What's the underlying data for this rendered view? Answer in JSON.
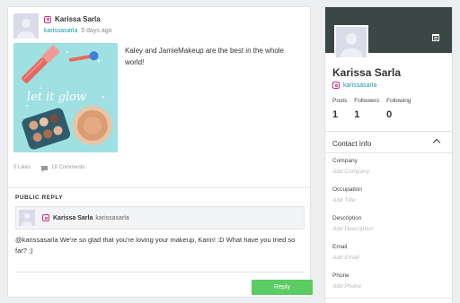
{
  "post": {
    "author_name": "Karissa Sarla",
    "author_handle": "karissasarla",
    "time_ago": "5 days ago",
    "text": "Kaley and JamieMakeup are the best in the whole world!",
    "image_caption": "let it glow",
    "likes": "0 Likes",
    "comments": "18 Comments"
  },
  "reply": {
    "section_title": "PUBLIC REPLY",
    "author_name": "Karissa Sarla",
    "author_handle": "karissasarla",
    "text": "@karissasarla  We're so glad that you're loving your makeup, Karin! :D What have you tried so far? ;)",
    "button_label": "Reply"
  },
  "profile": {
    "name": "Karissa Sarla",
    "handle": "karissasarla",
    "stats": [
      {
        "label": "Posts",
        "value": "1"
      },
      {
        "label": "Followers",
        "value": "1"
      },
      {
        "label": "Following",
        "value": "0"
      }
    ],
    "contact_title": "Contact Info",
    "fields": [
      {
        "label": "Company",
        "placeholder": "Add Company"
      },
      {
        "label": "Occupation",
        "placeholder": "Add Title"
      },
      {
        "label": "Description",
        "placeholder": "Add Description"
      },
      {
        "label": "Email",
        "placeholder": "Add Email"
      },
      {
        "label": "Phone",
        "placeholder": "Add Phone"
      }
    ]
  },
  "colors": {
    "banner": "#3b4744",
    "accent_teal": "#1a9aa5",
    "reply_button": "#5bcb64",
    "instagram": "#c13584",
    "image_bg": "#9fe0e3"
  },
  "icons": [
    "instagram-icon",
    "comment-icon",
    "calendar-icon",
    "chevron-up-icon"
  ]
}
